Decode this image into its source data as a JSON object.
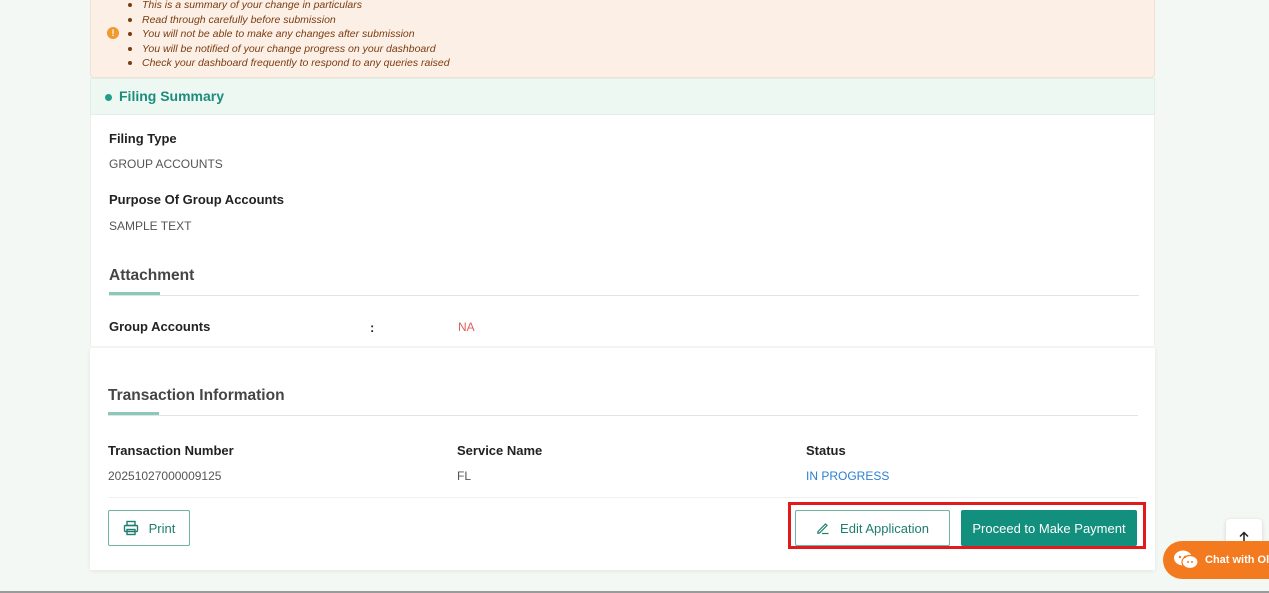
{
  "notice": {
    "icon": "warning-icon",
    "items": [
      "This is a summary of your change in particulars",
      "Read through carefully before submission",
      "You will not be able to make any changes after submission",
      "You will be notified of your change progress on your dashboard",
      "Check your dashboard frequently to respond to any queries raised"
    ]
  },
  "filing_summary": {
    "title": "Filing Summary",
    "filing_type_label": "Filing Type",
    "filing_type_value": "GROUP ACCOUNTS",
    "purpose_label": "Purpose Of Group Accounts",
    "purpose_value": "SAMPLE TEXT"
  },
  "attachment": {
    "title": "Attachment",
    "item_label": "Group Accounts",
    "separator": ":",
    "item_value": "NA"
  },
  "transaction": {
    "title": "Transaction Information",
    "number_label": "Transaction Number",
    "number_value": "20251027000009125",
    "service_label": "Service Name",
    "service_value": "FL",
    "status_label": "Status",
    "status_value": "IN PROGRESS"
  },
  "actions": {
    "print_label": "Print",
    "edit_label": "Edit Application",
    "payment_label": "Proceed to Make Payment"
  },
  "chat": {
    "label": "Chat with Olivia"
  },
  "colors": {
    "accent": "#138f7e",
    "status": "#2b7fd1",
    "na": "#e0605a",
    "highlight": "#e01b1b",
    "chat": "#f47a20"
  }
}
